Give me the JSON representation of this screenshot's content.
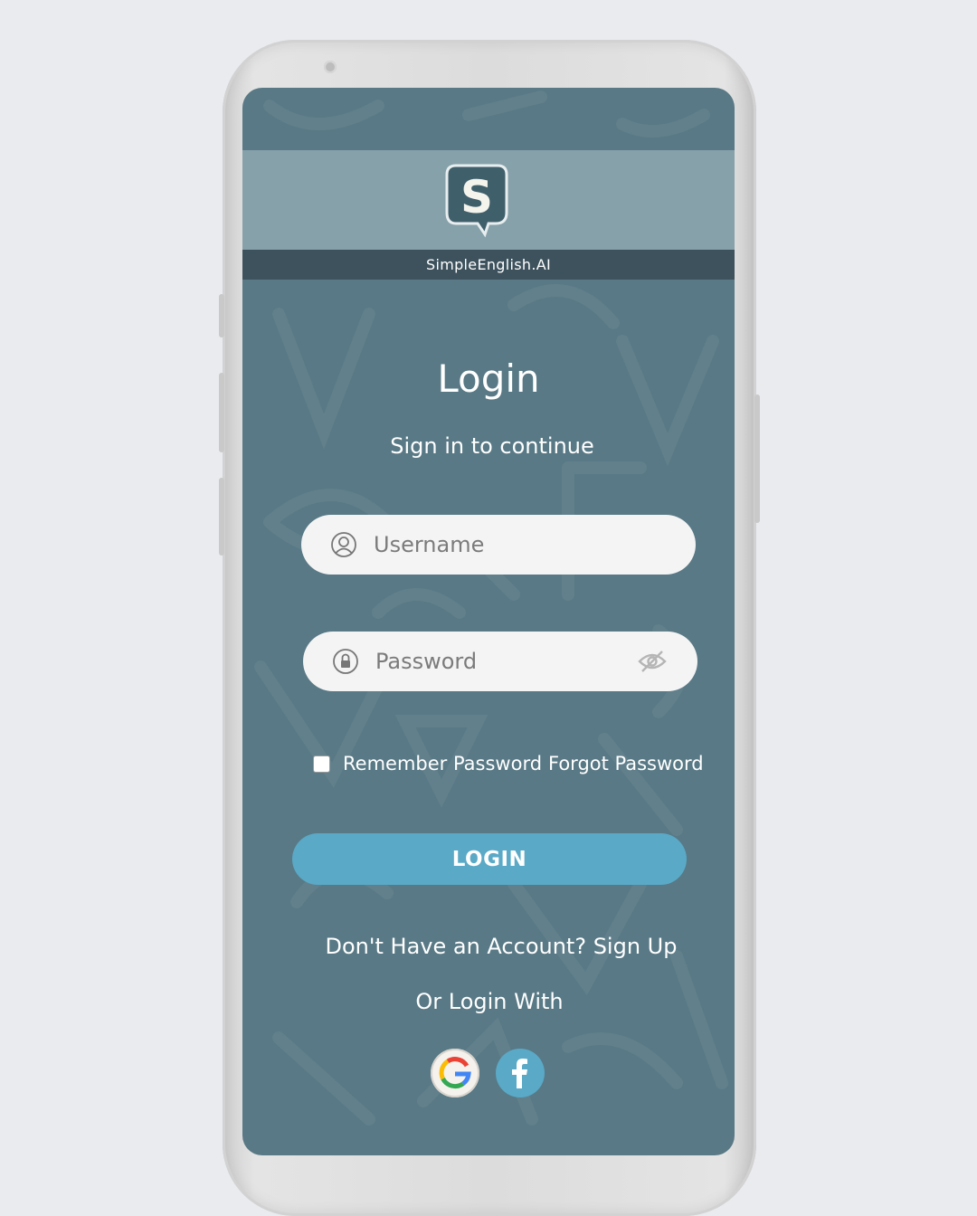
{
  "brand": {
    "name": "SimpleEnglish.AI",
    "logo_letter": "S"
  },
  "login": {
    "title": "Login",
    "subtitle": "Sign in to continue",
    "username_placeholder": "Username",
    "password_placeholder": "Password",
    "remember_label": "Remember Password",
    "remember_checked": false,
    "forgot_label": "Forgot Password",
    "login_button": "LOGIN",
    "signup_prompt": "Don't Have an Account? Sign Up",
    "alt_login_label": "Or Login With"
  },
  "icons": {
    "username": "user-circle-icon",
    "password": "lock-circle-icon",
    "visibility": "eye-off-icon",
    "google": "google-icon",
    "facebook": "facebook-icon"
  },
  "colors": {
    "screen_bg": "#587985",
    "brand_bar": "#3d525d",
    "accent": "#5aa9c6",
    "field_bg": "#f4f4f4",
    "page_bg": "#e9ebef"
  }
}
